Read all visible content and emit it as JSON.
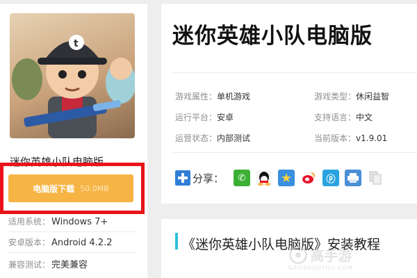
{
  "left": {
    "game_name": "迷你英雄小队电脑版",
    "download_label": "电脑版下载",
    "download_size": "50.0MB",
    "specs": [
      {
        "key": "适用系统：",
        "value": "Windows 7+"
      },
      {
        "key": "安卓版本：",
        "value": "Android 4.2.2"
      },
      {
        "key": "兼容测试：",
        "value": "完美兼容"
      }
    ]
  },
  "right": {
    "title": "迷你英雄小队电脑版",
    "attrs": [
      {
        "key": "游戏属性：",
        "value": "单机游戏"
      },
      {
        "key": "游戏类型：",
        "value": "休闲益智"
      },
      {
        "key": "运行平台：",
        "value": "安卓"
      },
      {
        "key": "支持语言：",
        "value": "中文"
      },
      {
        "key": "运营状态：",
        "value": "内部测试"
      },
      {
        "key": "当前版本：",
        "value": "v1.9.01"
      }
    ],
    "share_label": "分享：",
    "share_icons": [
      "wechat-icon",
      "qq-icon",
      "qzone-icon",
      "weibo-icon",
      "tencent-weibo-icon",
      "print-icon",
      "copy-icon"
    ]
  },
  "tutorial": {
    "title": "《迷你英雄小队电脑版》安装教程"
  },
  "watermark": {
    "text": "高手游",
    "url": "GAOSHOUYOU.COM"
  },
  "colors": {
    "accent_download": "#f6b444",
    "highlight_frame": "#e8141a",
    "share_blue": "#2f7fd6",
    "tutorial_bar": "#2fc0de"
  }
}
